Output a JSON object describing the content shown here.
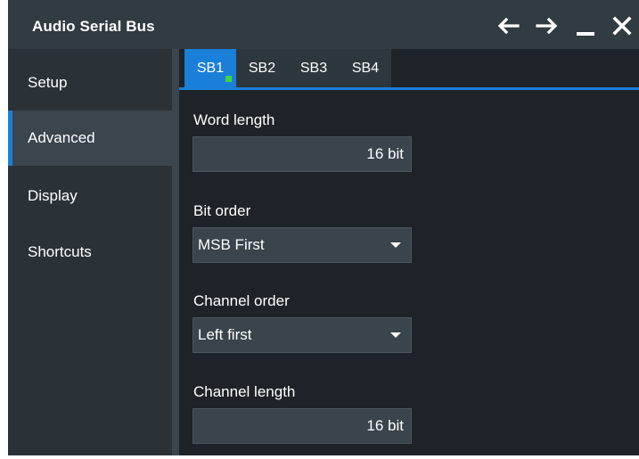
{
  "window": {
    "title": "Audio Serial Bus",
    "controls": [
      "arrow-left-icon",
      "arrow-right-icon",
      "minimize-icon",
      "close-icon"
    ]
  },
  "sidebar": {
    "items": [
      {
        "label": "Setup",
        "active": false
      },
      {
        "label": "Advanced",
        "active": true
      },
      {
        "label": "Display",
        "active": false
      },
      {
        "label": "Shortcuts",
        "active": false
      }
    ]
  },
  "tabs": [
    {
      "label": "SB1",
      "active": true,
      "indicator_color": "#3fd53f"
    },
    {
      "label": "SB2",
      "active": false
    },
    {
      "label": "SB3",
      "active": false
    },
    {
      "label": "SB4",
      "active": false
    }
  ],
  "fields": {
    "word_length": {
      "label": "Word length",
      "value": "16 bit"
    },
    "bit_order": {
      "label": "Bit order",
      "value": "MSB First"
    },
    "channel_order": {
      "label": "Channel order",
      "value": "Left first"
    },
    "channel_length": {
      "label": "Channel length",
      "value": "16 bit"
    }
  },
  "colors": {
    "accent": "#1a7fd9",
    "panel_bg": "#1d2328",
    "sidebar_bg": "#2a3238",
    "titlebar_bg": "#313b42",
    "field_bg": "#39444c"
  }
}
